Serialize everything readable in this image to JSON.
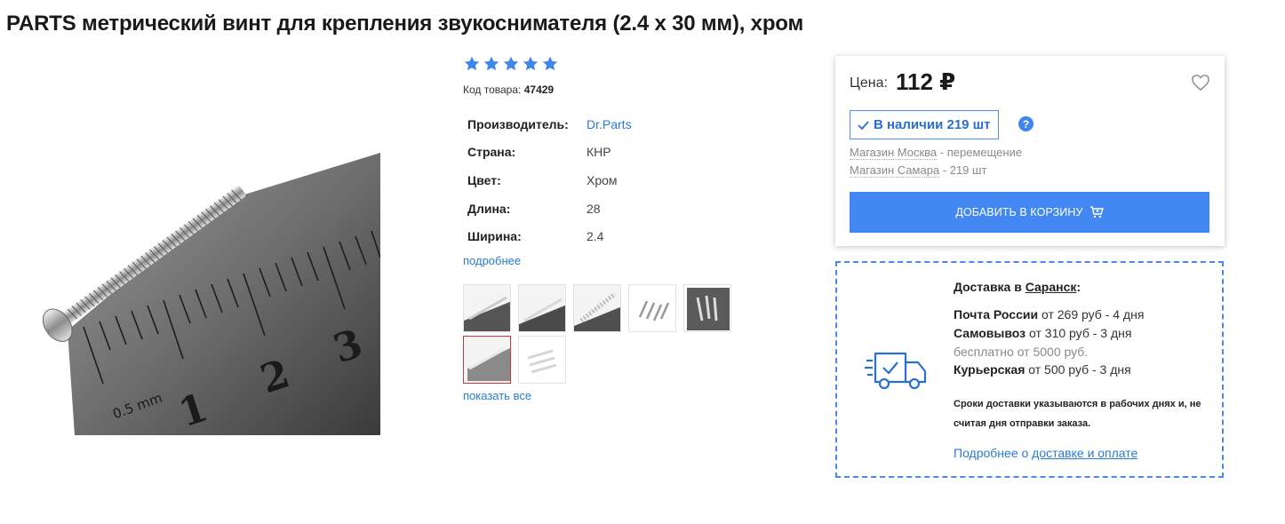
{
  "product": {
    "title": "PARTS метрический винт для крепления звукоснимателя (2.4 x 30 мм), хром",
    "rating_stars": 5,
    "sku_label": "Код товара:",
    "sku_value": "47429",
    "properties": [
      {
        "name": "Производитель:",
        "value": "Dr.Parts"
      },
      {
        "name": "Страна:",
        "value": "КНР"
      },
      {
        "name": "Цвет:",
        "value": "Хром"
      },
      {
        "name": "Длина:",
        "value": "28"
      },
      {
        "name": "Ширина:",
        "value": "2.4"
      }
    ],
    "more_link": "подробнее",
    "show_all_link": "показать все",
    "thumbnail_count": 7,
    "active_thumbnail": 6,
    "photo_ruler_text": "0.5 mm"
  },
  "price_card": {
    "price_label": "Цена:",
    "price_value": "112 ₽",
    "stock_label": "В наличии 219 шт",
    "help_glyph": "?",
    "stores": [
      {
        "name": "Магазин Москва",
        "status": " - перемещение"
      },
      {
        "name": "Магазин Самара",
        "status": " - 219 шт"
      }
    ],
    "cart_button": "ДОБАВИТЬ В КОРЗИНУ"
  },
  "delivery": {
    "title_prefix": "Доставка в ",
    "city": "Саранск",
    "title_suffix": ":",
    "options": [
      {
        "name": "Почта России",
        "detail": " от 269 руб - 4 дня"
      },
      {
        "name": "Самовывоз",
        "detail": " от 310 руб - 3 дня"
      }
    ],
    "free_note": "бесплатно от 5000 руб.",
    "courier": {
      "name": "Курьерская",
      "detail": " от 500 руб - 3 дня"
    },
    "note": "Сроки доставки указываются в рабочих днях и, не считая дня отправки заказа.",
    "more_prefix": "Подробнее о ",
    "more_link": "доставке и оплате"
  },
  "colors": {
    "accent": "#4388f2",
    "link": "#2a7ad6",
    "active_thumb_border": "#c83a3a"
  },
  "icons": [
    "star-icon",
    "heart-icon",
    "check-icon",
    "help-icon",
    "cart-icon",
    "truck-icon"
  ]
}
